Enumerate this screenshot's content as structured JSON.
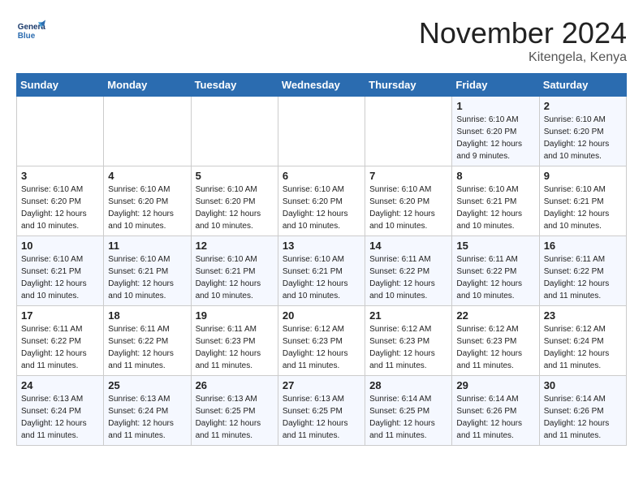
{
  "header": {
    "logo_line1": "General",
    "logo_line2": "Blue",
    "month": "November 2024",
    "location": "Kitengela, Kenya"
  },
  "weekdays": [
    "Sunday",
    "Monday",
    "Tuesday",
    "Wednesday",
    "Thursday",
    "Friday",
    "Saturday"
  ],
  "weeks": [
    [
      {
        "day": "",
        "info": ""
      },
      {
        "day": "",
        "info": ""
      },
      {
        "day": "",
        "info": ""
      },
      {
        "day": "",
        "info": ""
      },
      {
        "day": "",
        "info": ""
      },
      {
        "day": "1",
        "info": "Sunrise: 6:10 AM\nSunset: 6:20 PM\nDaylight: 12 hours\nand 9 minutes."
      },
      {
        "day": "2",
        "info": "Sunrise: 6:10 AM\nSunset: 6:20 PM\nDaylight: 12 hours\nand 10 minutes."
      }
    ],
    [
      {
        "day": "3",
        "info": "Sunrise: 6:10 AM\nSunset: 6:20 PM\nDaylight: 12 hours\nand 10 minutes."
      },
      {
        "day": "4",
        "info": "Sunrise: 6:10 AM\nSunset: 6:20 PM\nDaylight: 12 hours\nand 10 minutes."
      },
      {
        "day": "5",
        "info": "Sunrise: 6:10 AM\nSunset: 6:20 PM\nDaylight: 12 hours\nand 10 minutes."
      },
      {
        "day": "6",
        "info": "Sunrise: 6:10 AM\nSunset: 6:20 PM\nDaylight: 12 hours\nand 10 minutes."
      },
      {
        "day": "7",
        "info": "Sunrise: 6:10 AM\nSunset: 6:20 PM\nDaylight: 12 hours\nand 10 minutes."
      },
      {
        "day": "8",
        "info": "Sunrise: 6:10 AM\nSunset: 6:21 PM\nDaylight: 12 hours\nand 10 minutes."
      },
      {
        "day": "9",
        "info": "Sunrise: 6:10 AM\nSunset: 6:21 PM\nDaylight: 12 hours\nand 10 minutes."
      }
    ],
    [
      {
        "day": "10",
        "info": "Sunrise: 6:10 AM\nSunset: 6:21 PM\nDaylight: 12 hours\nand 10 minutes."
      },
      {
        "day": "11",
        "info": "Sunrise: 6:10 AM\nSunset: 6:21 PM\nDaylight: 12 hours\nand 10 minutes."
      },
      {
        "day": "12",
        "info": "Sunrise: 6:10 AM\nSunset: 6:21 PM\nDaylight: 12 hours\nand 10 minutes."
      },
      {
        "day": "13",
        "info": "Sunrise: 6:10 AM\nSunset: 6:21 PM\nDaylight: 12 hours\nand 10 minutes."
      },
      {
        "day": "14",
        "info": "Sunrise: 6:11 AM\nSunset: 6:22 PM\nDaylight: 12 hours\nand 10 minutes."
      },
      {
        "day": "15",
        "info": "Sunrise: 6:11 AM\nSunset: 6:22 PM\nDaylight: 12 hours\nand 10 minutes."
      },
      {
        "day": "16",
        "info": "Sunrise: 6:11 AM\nSunset: 6:22 PM\nDaylight: 12 hours\nand 11 minutes."
      }
    ],
    [
      {
        "day": "17",
        "info": "Sunrise: 6:11 AM\nSunset: 6:22 PM\nDaylight: 12 hours\nand 11 minutes."
      },
      {
        "day": "18",
        "info": "Sunrise: 6:11 AM\nSunset: 6:22 PM\nDaylight: 12 hours\nand 11 minutes."
      },
      {
        "day": "19",
        "info": "Sunrise: 6:11 AM\nSunset: 6:23 PM\nDaylight: 12 hours\nand 11 minutes."
      },
      {
        "day": "20",
        "info": "Sunrise: 6:12 AM\nSunset: 6:23 PM\nDaylight: 12 hours\nand 11 minutes."
      },
      {
        "day": "21",
        "info": "Sunrise: 6:12 AM\nSunset: 6:23 PM\nDaylight: 12 hours\nand 11 minutes."
      },
      {
        "day": "22",
        "info": "Sunrise: 6:12 AM\nSunset: 6:23 PM\nDaylight: 12 hours\nand 11 minutes."
      },
      {
        "day": "23",
        "info": "Sunrise: 6:12 AM\nSunset: 6:24 PM\nDaylight: 12 hours\nand 11 minutes."
      }
    ],
    [
      {
        "day": "24",
        "info": "Sunrise: 6:13 AM\nSunset: 6:24 PM\nDaylight: 12 hours\nand 11 minutes."
      },
      {
        "day": "25",
        "info": "Sunrise: 6:13 AM\nSunset: 6:24 PM\nDaylight: 12 hours\nand 11 minutes."
      },
      {
        "day": "26",
        "info": "Sunrise: 6:13 AM\nSunset: 6:25 PM\nDaylight: 12 hours\nand 11 minutes."
      },
      {
        "day": "27",
        "info": "Sunrise: 6:13 AM\nSunset: 6:25 PM\nDaylight: 12 hours\nand 11 minutes."
      },
      {
        "day": "28",
        "info": "Sunrise: 6:14 AM\nSunset: 6:25 PM\nDaylight: 12 hours\nand 11 minutes."
      },
      {
        "day": "29",
        "info": "Sunrise: 6:14 AM\nSunset: 6:26 PM\nDaylight: 12 hours\nand 11 minutes."
      },
      {
        "day": "30",
        "info": "Sunrise: 6:14 AM\nSunset: 6:26 PM\nDaylight: 12 hours\nand 11 minutes."
      }
    ]
  ]
}
